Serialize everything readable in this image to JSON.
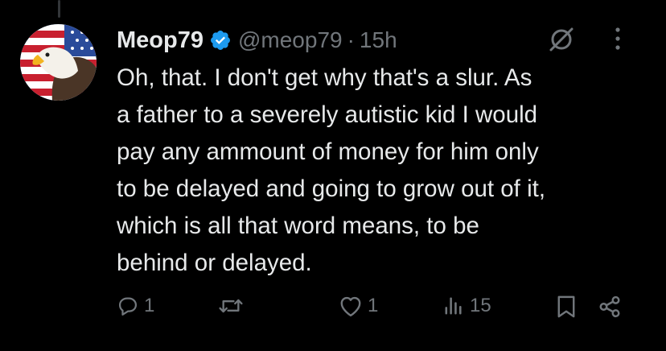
{
  "tweet": {
    "display_name": "Meop79",
    "handle": "@meop79",
    "separator": "·",
    "time": "15h",
    "text": "Oh, that.  I don't get why that's a slur.  As\na father to a severely autistic kid I would\npay any ammount of money for him only\nto be delayed and going to grow out of it,\nwhich is all that word means, to be\nbehind or delayed."
  },
  "actions": {
    "reply_count": "1",
    "repost_count": "",
    "like_count": "1",
    "views_count": "15"
  },
  "icons": {
    "verified": "verified-badge-icon",
    "grok": "grok-icon",
    "more": "more-icon",
    "reply": "reply-icon",
    "repost": "repost-icon",
    "like": "like-icon",
    "views": "views-icon",
    "bookmark": "bookmark-icon",
    "share": "share-icon"
  },
  "colors": {
    "background": "#000000",
    "text": "#e7e9ea",
    "secondary": "#71767b",
    "verified": "#1d9bf0"
  }
}
